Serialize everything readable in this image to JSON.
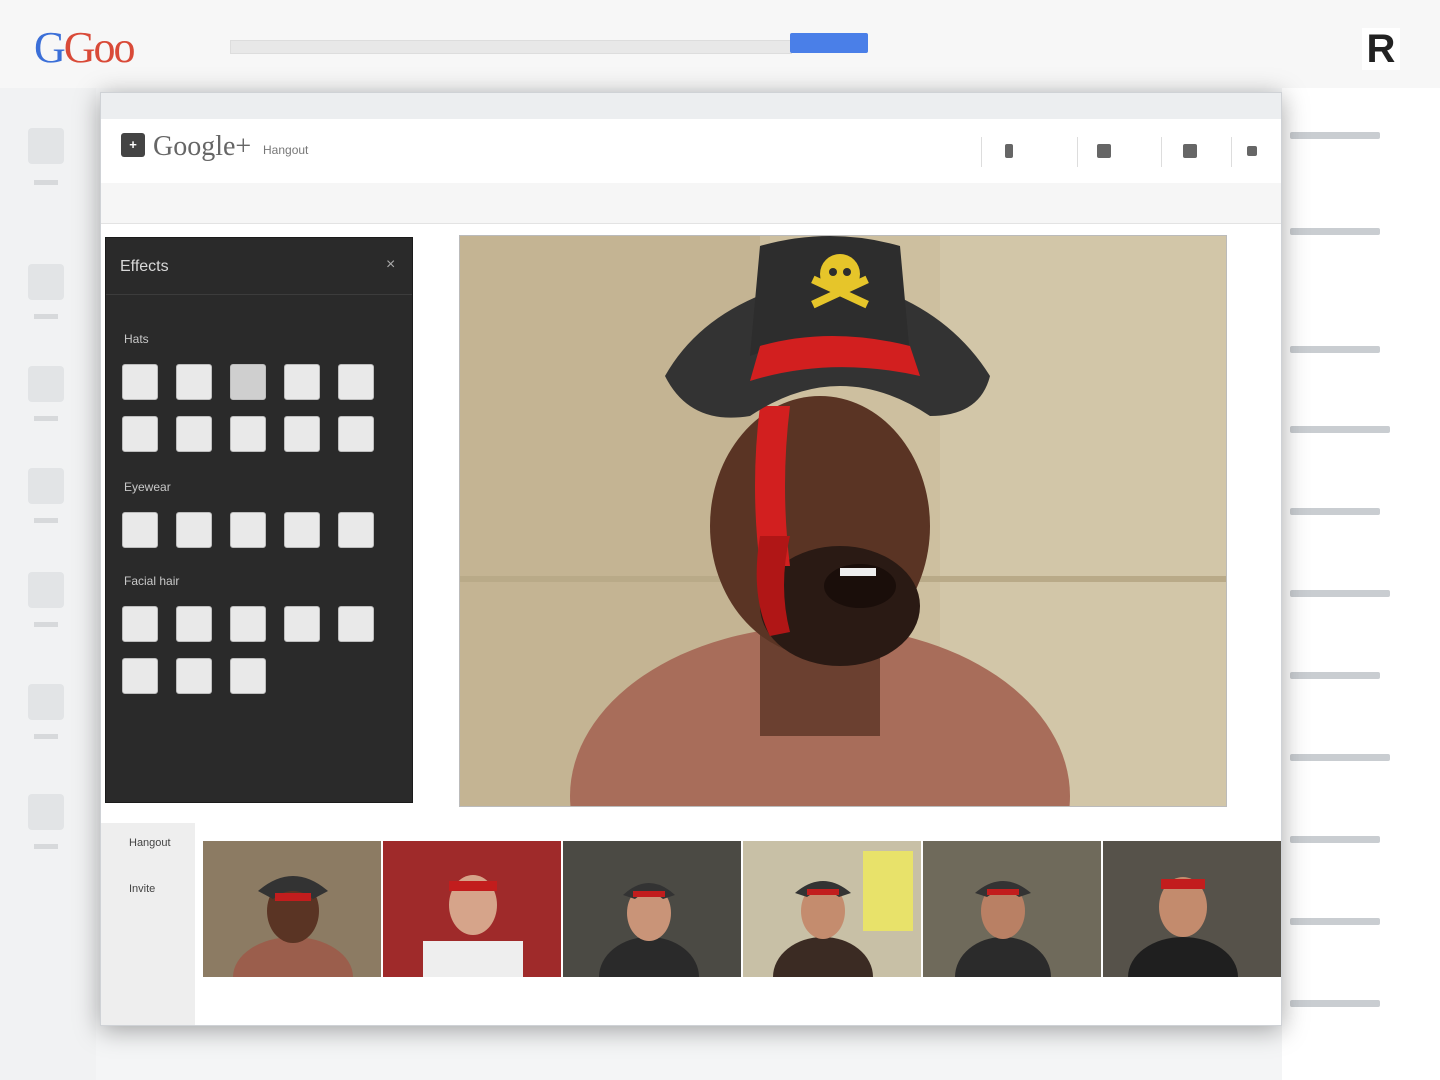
{
  "background": {
    "logo_text": "Goo",
    "avatar_letter": "R"
  },
  "window": {
    "app_logo": "Google+",
    "app_subtitle": "Hangout"
  },
  "effects_panel": {
    "title": "Effects",
    "close_symbol": "×",
    "sections": [
      {
        "label": "Hats"
      },
      {
        "label": "Eyewear"
      },
      {
        "label": "Facial hair"
      }
    ]
  },
  "bottom": {
    "tabs": [
      "Hangout",
      "Invite"
    ]
  },
  "colors": {
    "panel_bg": "#2a2a2a",
    "accent_blue": "#4a7fe8",
    "hat_red": "#d21f1f"
  }
}
